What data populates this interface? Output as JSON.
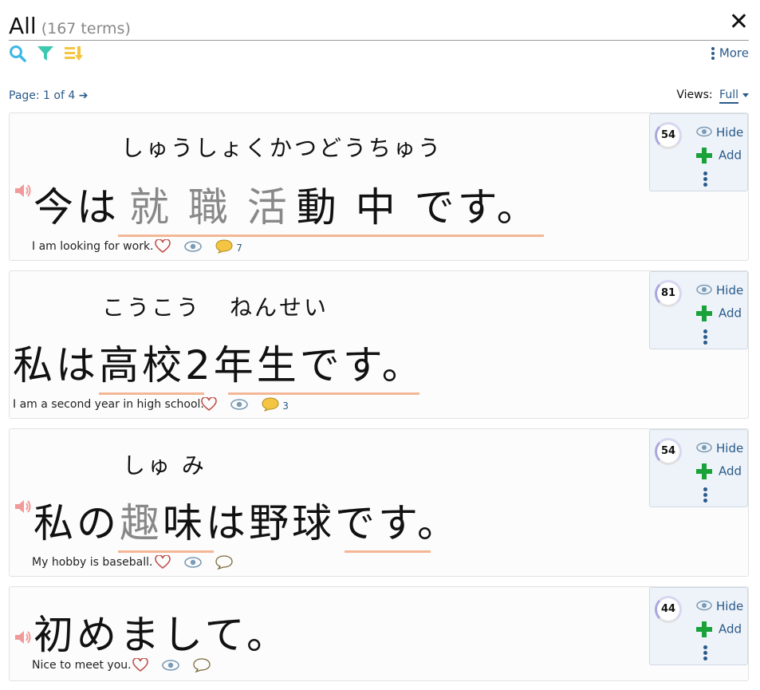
{
  "header": {
    "title": "All",
    "count": "(167 terms)",
    "more_label": "More"
  },
  "pager": {
    "text": "Page: 1 of 4"
  },
  "views": {
    "label": "Views:",
    "selected": "Full"
  },
  "panel": {
    "hide_label": "Hide",
    "add_label": "Add"
  },
  "icons": {
    "search": "search-icon",
    "filter": "filter-icon",
    "sort": "sort-icon",
    "close": "close-icon",
    "speaker": "speaker-icon",
    "heart": "heart-icon",
    "eye": "eye-icon",
    "comment": "comment-icon",
    "plus": "plus-icon"
  },
  "colors": {
    "accent": "#2a5a8a",
    "underline": "#f4b796",
    "add": "#1aa23a",
    "speaker": "#f19a9a",
    "comment": "#f4c542"
  },
  "cards": [
    {
      "score": "54",
      "furigana": "しゅうしょくかつどうちゅう",
      "jp_prefix": "今は",
      "jp_muted": "就 職 活",
      "jp_rest": "動 中 です。",
      "english": "I am looking for work.",
      "comments": "7"
    },
    {
      "score": "81",
      "furigana_a": "こうこう",
      "furigana_b": "ねんせい",
      "japanese": "私は高校2年生です。",
      "english": "I am a second year in high school.",
      "comments": "3"
    },
    {
      "score": "54",
      "furigana": "しゅ み",
      "jp_prefix": "私の",
      "jp_muted": "趣",
      "jp_rest": "味は野球です。",
      "english": "My hobby is baseball.",
      "comments": ""
    },
    {
      "score": "44",
      "japanese": "初めまして。",
      "english": "Nice to meet you.",
      "comments": ""
    }
  ]
}
